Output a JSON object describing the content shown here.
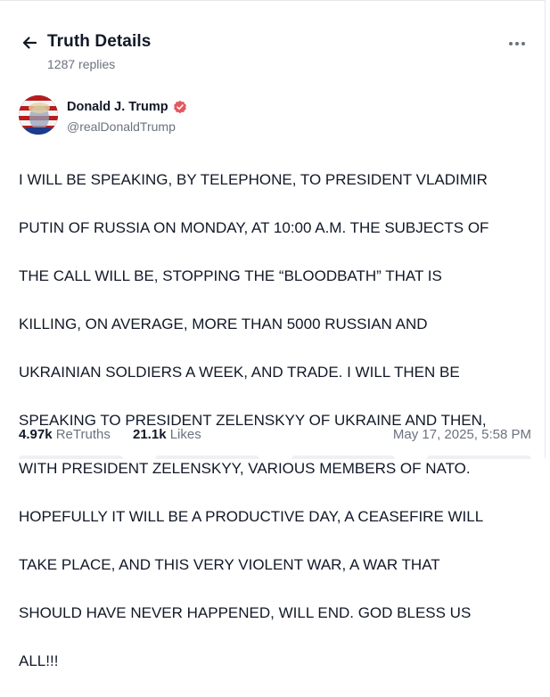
{
  "header": {
    "title": "Truth Details",
    "replies": "1287 replies"
  },
  "author": {
    "name": "Donald J. Trump",
    "handle": "@realDonaldTrump",
    "verified_color": "#e5575e"
  },
  "post": {
    "lines": [
      "I WILL BE SPEAKING, BY TELEPHONE, TO PRESIDENT VLADIMIR",
      "PUTIN OF RUSSIA ON MONDAY, AT 10:00 A.M. THE SUBJECTS OF",
      "THE CALL WILL BE, STOPPING THE “BLOODBATH” THAT IS",
      "KILLING, ON AVERAGE, MORE THAN 5000 RUSSIAN AND",
      "UKRAINIAN SOLDIERS A WEEK, AND TRADE. I WILL THEN BE",
      "SPEAKING TO PRESIDENT ZELENSKYY OF UKRAINE AND THEN,",
      "WITH PRESIDENT ZELENSKYY, VARIOUS MEMBERS OF NATO.",
      "HOPEFULLY IT WILL BE A PRODUCTIVE DAY, A CEASEFIRE WILL",
      "TAKE PLACE, AND THIS VERY VIOLENT WAR, A WAR THAT",
      "SHOULD HAVE NEVER HAPPENED, WILL END. GOD BLESS US",
      "ALL!!!"
    ]
  },
  "stats": {
    "retruths_count": "4.97k",
    "retruths_label": "ReTruths",
    "likes_count": "21.1k",
    "likes_label": "Likes",
    "timestamp": "May 17, 2025, 5:58 PM"
  },
  "icons": {
    "back": "arrow-left-icon",
    "more": "more-horizontal-icon",
    "verified": "verified-badge-icon"
  }
}
